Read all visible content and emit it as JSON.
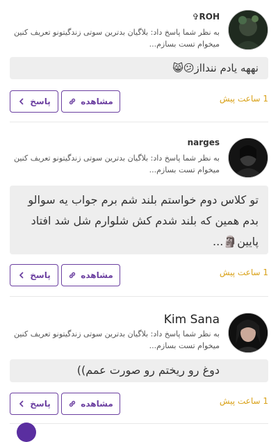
{
  "comments": [
    {
      "username": "✞ROH",
      "reply_note": "به نظر شما پاسخ داد: بلاگیان بدترین سوتی زندگیتونو تعریف کنین میخوام تست بسازم...",
      "text": "نههه یادم نندااز😕😸",
      "time": "1 ساعت پیش",
      "view_label": "مشاهده",
      "reply_label": "پاسخ"
    },
    {
      "username": "narges",
      "reply_note": "به نظر شما پاسخ داد: بلاگیان بدترین سوتی زندگیتونو تعریف کنین میخوام تست بسازم...",
      "text": "تو کلاس دوم خواستم بلند شم برم جواب یه سوالو بدم همین که بلند شدم کش شلوارم شل شد افتاد پایین🗿...",
      "time": "1 ساعت پیش",
      "view_label": "مشاهده",
      "reply_label": "پاسخ"
    },
    {
      "username": "Kim Sana",
      "reply_note": "به نظر شما پاسخ داد: بلاگیان بدترین سوتی زندگیتونو تعریف کنین میخوام تست بسازم...",
      "text": "دوغ رو ریختم رو صورت عمم))",
      "time": "1 ساعت پیش",
      "view_label": "مشاهده",
      "reply_label": "پاسخ"
    }
  ],
  "colors": {
    "accent": "#6b3fa0",
    "time": "#d9a21a",
    "bubble_bg": "#eeeeee"
  },
  "icons": {
    "view": "link-icon",
    "reply": "chevron-left-icon"
  }
}
